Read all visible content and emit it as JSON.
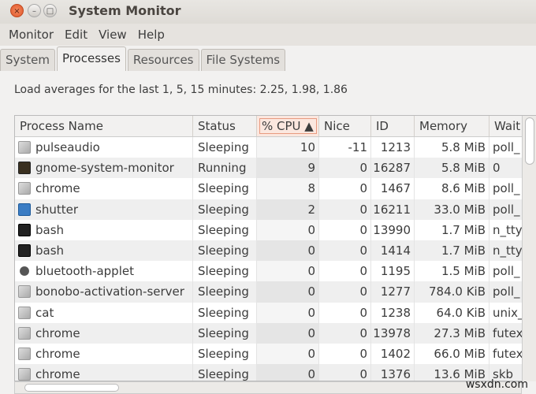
{
  "window": {
    "title": "System Monitor"
  },
  "menu": [
    "Monitor",
    "Edit",
    "View",
    "Help"
  ],
  "tabs": [
    "System",
    "Processes",
    "Resources",
    "File Systems"
  ],
  "load_text": "Load averages for the last 1, 5, 15 minutes: 2.25, 1.98, 1.86",
  "columns": [
    "Process Name",
    "Status",
    "% CPU ▲",
    "Nice",
    "ID",
    "Memory",
    "Wait"
  ],
  "rows": [
    {
      "icon": "generic",
      "name": "pulseaudio",
      "status": "Sleeping",
      "cpu": "10",
      "nice": "-11",
      "id": "1213",
      "mem": "5.8 MiB",
      "wait": "poll_"
    },
    {
      "icon": "gsm",
      "name": "gnome-system-monitor",
      "status": "Running",
      "cpu": "9",
      "nice": "0",
      "id": "16287",
      "mem": "5.8 MiB",
      "wait": "0"
    },
    {
      "icon": "generic",
      "name": "chrome",
      "status": "Sleeping",
      "cpu": "8",
      "nice": "0",
      "id": "1467",
      "mem": "8.6 MiB",
      "wait": "poll_"
    },
    {
      "icon": "shutter",
      "name": "shutter",
      "status": "Sleeping",
      "cpu": "2",
      "nice": "0",
      "id": "16211",
      "mem": "33.0 MiB",
      "wait": "poll_"
    },
    {
      "icon": "term",
      "name": "bash",
      "status": "Sleeping",
      "cpu": "0",
      "nice": "0",
      "id": "13990",
      "mem": "1.7 MiB",
      "wait": "n_tty"
    },
    {
      "icon": "term",
      "name": "bash",
      "status": "Sleeping",
      "cpu": "0",
      "nice": "0",
      "id": "1414",
      "mem": "1.7 MiB",
      "wait": "n_tty"
    },
    {
      "icon": "bt",
      "name": "bluetooth-applet",
      "status": "Sleeping",
      "cpu": "0",
      "nice": "0",
      "id": "1195",
      "mem": "1.5 MiB",
      "wait": "poll_"
    },
    {
      "icon": "generic",
      "name": "bonobo-activation-server",
      "status": "Sleeping",
      "cpu": "0",
      "nice": "0",
      "id": "1277",
      "mem": "784.0 KiB",
      "wait": "poll_"
    },
    {
      "icon": "generic",
      "name": "cat",
      "status": "Sleeping",
      "cpu": "0",
      "nice": "0",
      "id": "1238",
      "mem": "64.0 KiB",
      "wait": "unix_"
    },
    {
      "icon": "generic",
      "name": "chrome",
      "status": "Sleeping",
      "cpu": "0",
      "nice": "0",
      "id": "13978",
      "mem": "27.3 MiB",
      "wait": "futex"
    },
    {
      "icon": "generic",
      "name": "chrome",
      "status": "Sleeping",
      "cpu": "0",
      "nice": "0",
      "id": "1402",
      "mem": "66.0 MiB",
      "wait": "futex"
    },
    {
      "icon": "generic",
      "name": "chrome",
      "status": "Sleeping",
      "cpu": "0",
      "nice": "0",
      "id": "1376",
      "mem": "13.6 MiB",
      "wait": "skb"
    }
  ],
  "watermark": "wsxdn.com"
}
